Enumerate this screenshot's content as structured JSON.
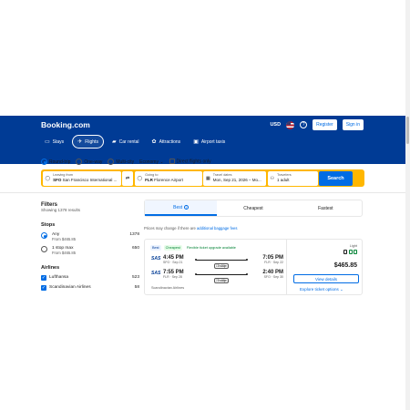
{
  "header": {
    "logo": "Booking.com",
    "currency": "USD",
    "help": "?",
    "register": "Register",
    "sign_in": "Sign in",
    "nav": [
      {
        "label": "Stays",
        "icon": "bed-icon"
      },
      {
        "label": "Flights",
        "icon": "plane-icon"
      },
      {
        "label": "Car rental",
        "icon": "car-icon"
      },
      {
        "label": "Attractions",
        "icon": "attractions-icon"
      },
      {
        "label": "Airport taxis",
        "icon": "taxi-icon"
      }
    ]
  },
  "search": {
    "trip_types": {
      "round_trip": "Round-trip",
      "one_way": "One-way",
      "multi_city": "Multi-city"
    },
    "cabin": "Economy",
    "direct_only": "Direct flights only",
    "from_label": "Leaving from",
    "from_code": "SFO",
    "from_name": "San Francisco International ...",
    "to_label": "Going to",
    "to_code": "FLR",
    "to_name": "Florence Airport",
    "dates_label": "Travel dates",
    "dates_value": "Mon, Sep 21, 2026 – Mo...",
    "travelers_label": "Travelers",
    "travelers_value": "1 adult",
    "search_button": "Search"
  },
  "filters": {
    "title": "Filters",
    "count": "Showing 1378 results",
    "stops_title": "Stops",
    "stops": [
      {
        "label": "Any",
        "sub": "From $465.85",
        "count": "1378"
      },
      {
        "label": "1 stop max",
        "sub": "From $465.85",
        "count": "650"
      }
    ],
    "airlines_title": "Airlines",
    "airlines": [
      {
        "label": "Lufthansa",
        "count": "523"
      },
      {
        "label": "Scandinavian Airlines",
        "count": "58"
      }
    ]
  },
  "results": {
    "tabs": {
      "best": "Best",
      "cheapest": "Cheapest",
      "fastest": "Fastest"
    },
    "notice_prefix": "Prices may change if there are",
    "notice_link": "additional baggage fees",
    "card": {
      "badges": {
        "best": "Best",
        "cheapest": "Cheapest",
        "flex": "Flexible ticket upgrade available"
      },
      "outbound": {
        "dep_time": "4:45 PM",
        "dep_meta": "SFO · Sep 21",
        "stops": "1 stop",
        "duration": "17h 20m",
        "arr_time": "7:05 PM",
        "arr_meta": "FLR · Sep 22"
      },
      "inbound": {
        "dep_time": "7:55 PM",
        "dep_meta": "FLR · Sep 28",
        "stops": "1 stop",
        "duration": "27h 45m",
        "arr_time": "2:40 PM",
        "arr_meta": "SFO · Sep 30"
      },
      "carrier": "Scandinavian Airlines",
      "fare": "Light",
      "price": "$465.85",
      "details_button": "View details",
      "explore_link": "Explore ticket options"
    }
  }
}
